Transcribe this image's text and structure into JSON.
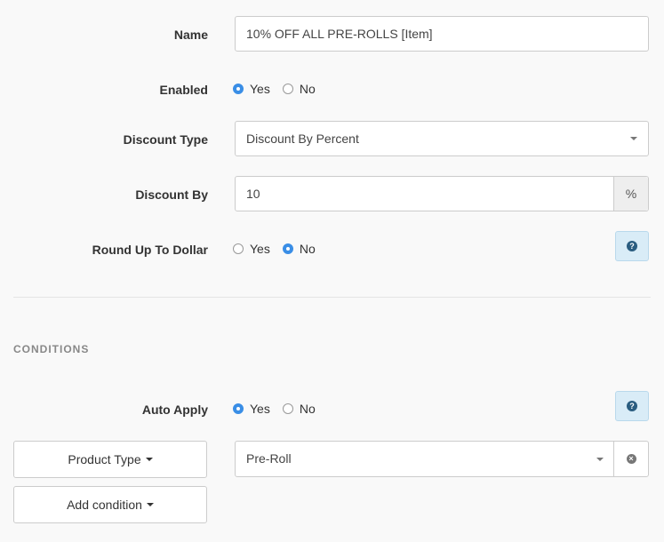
{
  "form": {
    "name": {
      "label": "Name",
      "value": "10% OFF ALL PRE-ROLLS [Item]"
    },
    "enabled": {
      "label": "Enabled",
      "options": [
        "Yes",
        "No"
      ],
      "selected": "Yes"
    },
    "discount_type": {
      "label": "Discount Type",
      "value": "Discount By Percent"
    },
    "discount_by": {
      "label": "Discount By",
      "value": "10",
      "addon": "%"
    },
    "round_up": {
      "label": "Round Up To Dollar",
      "options": [
        "Yes",
        "No"
      ],
      "selected": "No",
      "help_icon": "question-circle-icon"
    }
  },
  "conditions": {
    "heading": "CONDITIONS",
    "auto_apply": {
      "label": "Auto Apply",
      "options": [
        "Yes",
        "No"
      ],
      "selected": "Yes",
      "help_icon": "question-circle-icon"
    },
    "product_type_button": "Product Type",
    "product_type_value": "Pre-Roll",
    "add_condition_button": "Add condition"
  },
  "colors": {
    "accent": "#3a8ee6",
    "help_bg": "#d9ecf7"
  }
}
